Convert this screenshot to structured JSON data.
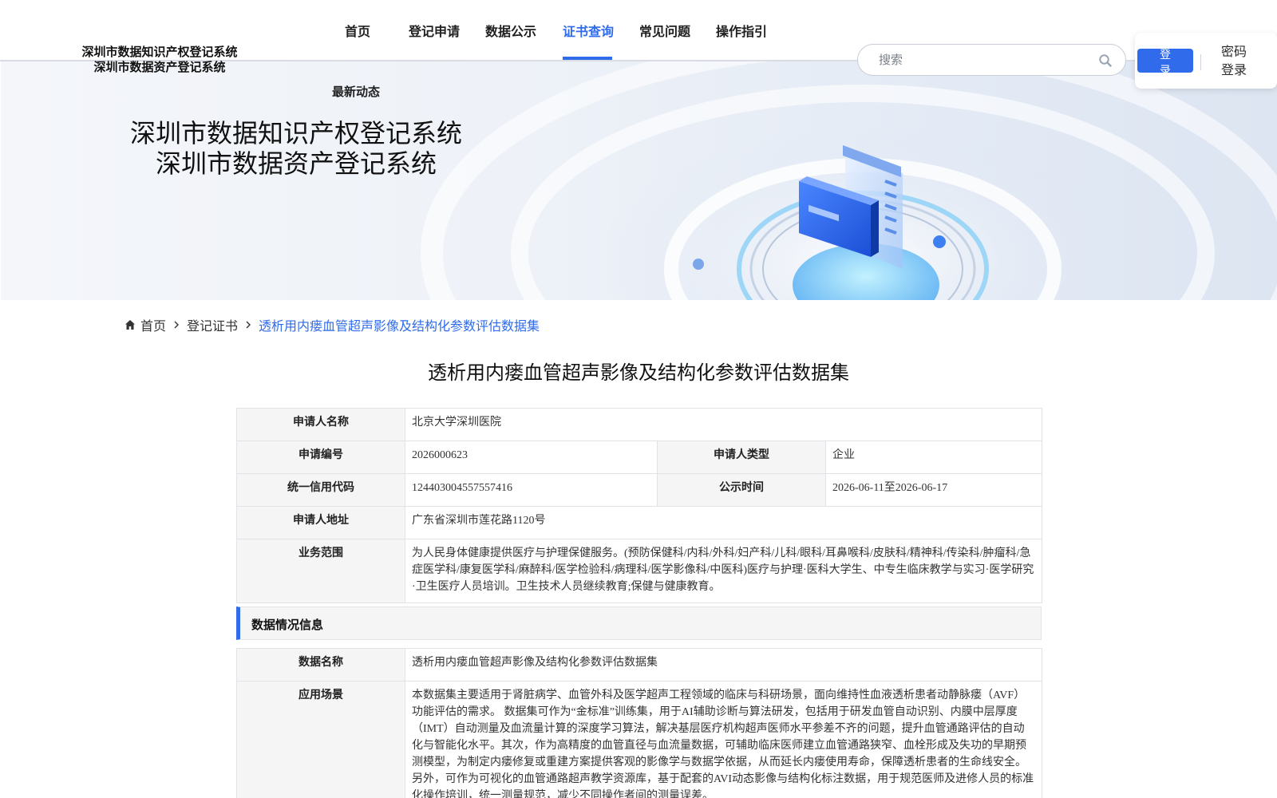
{
  "header": {
    "site_title_line1": "深圳市数据知识产权登记系统",
    "site_title_line2": "深圳市数据资产登记系统",
    "nav": [
      {
        "label": "首页",
        "active": false
      },
      {
        "label": "登记申请",
        "active": false
      },
      {
        "label": "数据公示",
        "active": false
      },
      {
        "label": "证书查询",
        "active": true
      },
      {
        "label": "常见问题",
        "active": false
      },
      {
        "label": "操作指引",
        "active": false
      }
    ],
    "sub_nav_label": "最新动态",
    "search": {
      "placeholder": "搜索",
      "icon": "search-icon"
    },
    "login_label": "登录",
    "password_login_label": "密码登录",
    "accent_color": "#2f6bea"
  },
  "banner": {
    "title_line1": "深圳市数据知识产权登记系统",
    "title_line2": "深圳市数据资产登记系统"
  },
  "breadcrumb": {
    "home_icon": "home-icon",
    "home_label": "首页",
    "level2_label": "登记证书",
    "current_label": "透析用内瘘血管超声影像及结构化参数评估数据集"
  },
  "page_title": "透析用内瘘血管超声影像及结构化参数评估数据集",
  "applicant": {
    "name_label": "申请人名称",
    "name_value": "北京大学深圳医院",
    "number_label": "申请编号",
    "number_value": "2026000623",
    "type_label": "申请人类型",
    "type_value": "企业",
    "credit_code_label": "统一信用代码",
    "credit_code_value": "124403004557557416",
    "publicity_label": "公示时间",
    "publicity_value": "2026-06-11至2026-06-17",
    "address_label": "申请人地址",
    "address_value": "广东省深圳市莲花路1120号",
    "scope_label": "业务范围",
    "scope_value": "为人民身体健康提供医疗与护理保健服务。(预防保健科/内科/外科/妇产科/儿科/眼科/耳鼻喉科/皮肤科/精神科/传染科/肿瘤科/急症医学科/康复医学科/麻醉科/医学检验科/病理科/医学影像科/中医科)医疗与护理·医科大学生、中专生临床教学与实习·医学研究·卫生医疗人员培训。卫生技术人员继续教育;保健与健康教育。"
  },
  "data_section": {
    "heading": "数据情况信息",
    "data_name_label": "数据名称",
    "data_name_value": "透析用内瘘血管超声影像及结构化参数评估数据集",
    "scenario_label": "应用场景",
    "scenario_value": "本数据集主要适用于肾脏病学、血管外科及医学超声工程领域的临床与科研场景，面向维持性血液透析患者动静脉瘘（AVF）功能评估的需求。 数据集可作为“金标准”训练集，用于AI辅助诊断与算法研发，包括用于研发血管自动识别、内膜中层厚度（IMT）自动测量及血流量计算的深度学习算法，解决基层医疗机构超声医师水平参差不齐的问题，提升血管通路评估的自动化与智能化水平。其次，作为高精度的血管直径与血流量数据，可辅助临床医师建立血管通路狭窄、血栓形成及失功的早期预测模型，为制定内瘘修复或重建方案提供客观的影像学与数据学依据，从而延长内瘘使用寿命，保障透析患者的生命线安全。另外，可作为可视化的血管通路超声教学资源库，基于配套的AVI动态影像与结构化标注数据，用于规范医师及进修人员的标准化操作培训，统一测量规范，减少不同操作者间的测量误差。"
  }
}
